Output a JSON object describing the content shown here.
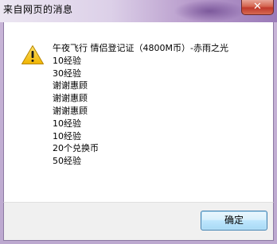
{
  "window": {
    "title": "来自网页的消息",
    "close_symbol": "✕"
  },
  "dialog": {
    "icon": "warning-triangle-icon",
    "lines": [
      "午夜飞行 情侣登记证（4800M币）-赤雨之光",
      "10经验",
      "30经验",
      "谢谢惠顾",
      "谢谢惠顾",
      "谢谢惠顾",
      "10经验",
      "10经验",
      "20个兑换币",
      "50经验"
    ]
  },
  "buttons": {
    "ok_label": "确定"
  },
  "colors": {
    "warning_fill": "#f5c400",
    "ok_border": "#3c7fb1"
  }
}
